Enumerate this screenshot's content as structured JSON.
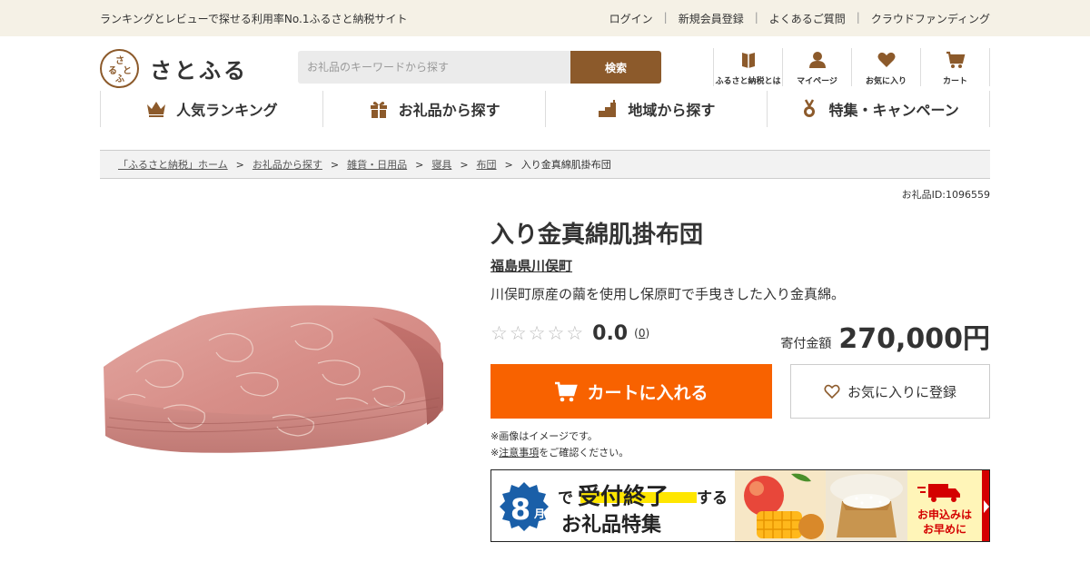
{
  "topbar": {
    "tagline": "ランキングとレビューで探せる利用率No.1ふるさと納税サイト",
    "links": [
      "ログイン",
      "新規会員登録",
      "よくあるご質問",
      "クラウドファンディング"
    ]
  },
  "logo": {
    "mark": "さとふる",
    "name": "さとふる"
  },
  "search": {
    "placeholder": "お礼品のキーワードから探す",
    "button": "検索"
  },
  "icon_nav": [
    {
      "label": "ふるさと納税とは",
      "icon": "book-icon"
    },
    {
      "label": "マイページ",
      "icon": "user-icon"
    },
    {
      "label": "お気に入り",
      "icon": "heart-icon"
    },
    {
      "label": "カート",
      "icon": "cart-icon"
    }
  ],
  "global_nav": [
    {
      "label": "人気ランキング",
      "icon": "crown-icon"
    },
    {
      "label": "お礼品から探す",
      "icon": "gift-icon"
    },
    {
      "label": "地域から探す",
      "icon": "region-icon"
    },
    {
      "label": "特集・キャンペーン",
      "icon": "medal-icon"
    }
  ],
  "breadcrumb": {
    "items": [
      "「ふるさと納税」ホーム",
      "お礼品から探す",
      "雑貨・日用品",
      "寝具",
      "布団"
    ],
    "current": "入り金真綿肌掛布団",
    "separator": ">"
  },
  "product": {
    "id_label": "お礼品ID:1096559",
    "title": "入り金真綿肌掛布団",
    "region": "福島県川俣町",
    "description": "川俣町原産の繭を使用し保原町で手曳きした入り金真綿。",
    "rating": {
      "stars": "☆",
      "score": "0.0",
      "count_open": "(",
      "count": "0",
      "count_close": ")"
    },
    "price_label": "寄付金額",
    "price": "270,000円",
    "cart_button": "カートに入れる",
    "favorite_button": "お気に入りに登録",
    "note1": "※画像はイメージです。",
    "note2_prefix": "※",
    "note2_link": "注意事項",
    "note2_suffix": "をご確認ください。"
  },
  "banner": {
    "month": "8",
    "month_unit": "月",
    "headline_de": "で",
    "headline_main": "受付終了",
    "headline_suru": "する",
    "headline_line2": "お礼品特集",
    "badge_line1": "お申込みは",
    "badge_line2": "お早めに"
  },
  "colors": {
    "brand_brown": "#8c5a2b",
    "cart_orange": "#f86200",
    "topbar_bg": "#f5f1e6",
    "banner_blue": "#1a5fa8",
    "banner_yellow": "#ffe600",
    "banner_red": "#d40000"
  }
}
